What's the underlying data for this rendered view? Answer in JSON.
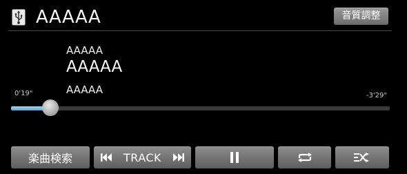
{
  "header": {
    "source_icon": "usb-icon",
    "title": "AAAAA",
    "sound_quality_label": "音質調整"
  },
  "track_info": {
    "artist": "AAAAA",
    "song": "AAAAA",
    "album": "AAAAA"
  },
  "playback": {
    "elapsed": "0'19\"",
    "remaining": "-3'29\"",
    "progress": 0.104
  },
  "controls": {
    "search_label": "楽曲検索",
    "track_label": "TRACK",
    "prev_icon": "skip-previous-icon",
    "next_icon": "skip-next-icon",
    "pause_icon": "pause-icon",
    "repeat_icon": "repeat-icon",
    "shuffle_icon": "shuffle-icon"
  },
  "colors": {
    "progress_fill": "#5aa9d6",
    "button": "#6b6b6b",
    "background": "#000000"
  }
}
